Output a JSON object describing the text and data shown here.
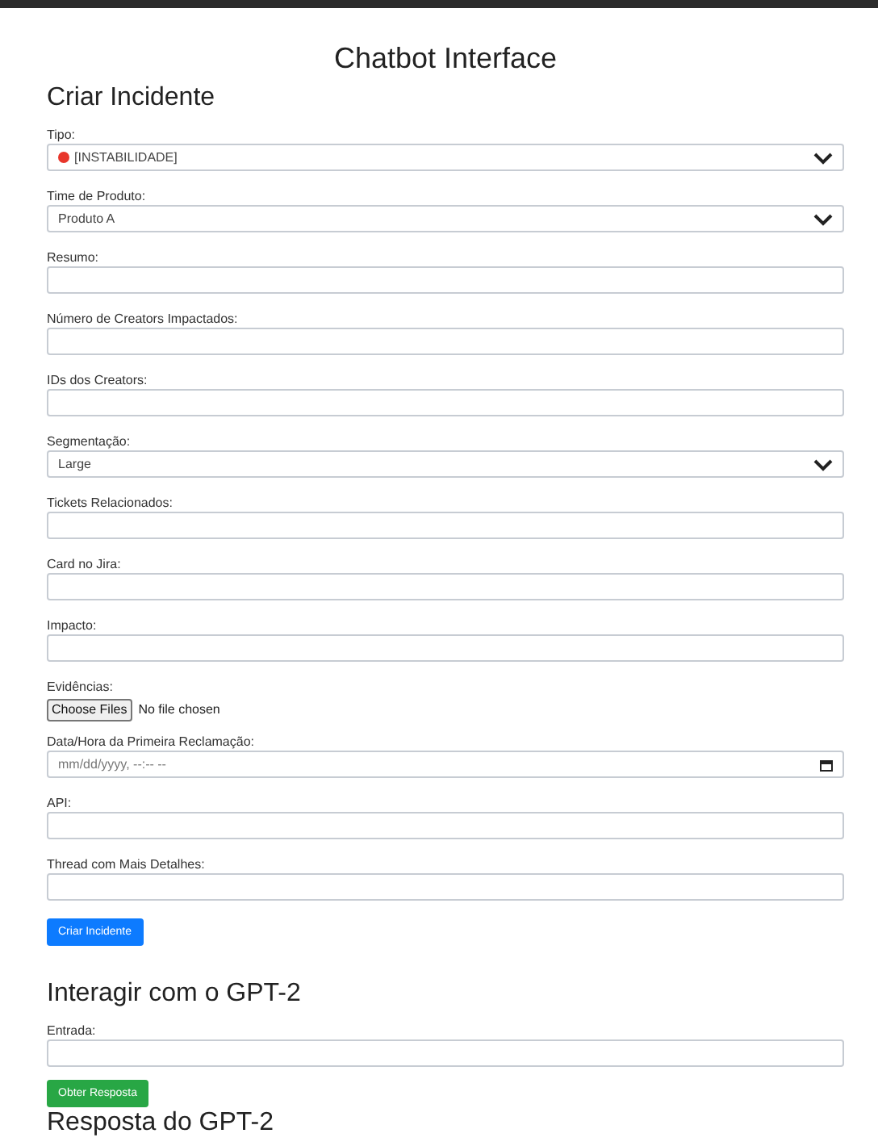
{
  "title": "Chatbot Interface",
  "incident_form": {
    "heading": "Criar Incidente",
    "fields": [
      {
        "kind": "select",
        "label": "Tipo:",
        "value": "[INSTABILIDADE]",
        "has_icon": true
      },
      {
        "kind": "select",
        "label": "Time de Produto:",
        "value": "Produto A",
        "has_icon": false
      },
      {
        "kind": "text",
        "label": "Resumo:"
      },
      {
        "kind": "text",
        "label": "Número de Creators Impactados:"
      },
      {
        "kind": "text",
        "label": "IDs dos Creators:"
      },
      {
        "kind": "select",
        "label": "Segmentação:",
        "value": "Large",
        "has_icon": false
      },
      {
        "kind": "text",
        "label": "Tickets Relacionados:"
      },
      {
        "kind": "text",
        "label": "Card no Jira:"
      },
      {
        "kind": "text",
        "label": "Impacto:"
      },
      {
        "kind": "file",
        "label": "Evidências:",
        "button": "Choose Files",
        "status": "No file chosen"
      },
      {
        "kind": "datetime",
        "label": "Data/Hora da Primeira Reclamação:",
        "placeholder": "mm/dd/yyyy, --:-- --"
      },
      {
        "kind": "text",
        "label": "API:"
      },
      {
        "kind": "text",
        "label": "Thread com Mais Detalhes:"
      }
    ],
    "submit": "Criar Incidente"
  },
  "gpt_form": {
    "heading": "Interagir com o GPT-2",
    "fields": [
      {
        "kind": "text",
        "label": "Entrada:"
      }
    ],
    "submit": "Obter Resposta"
  },
  "response": {
    "heading": "Resposta do GPT-2"
  }
}
